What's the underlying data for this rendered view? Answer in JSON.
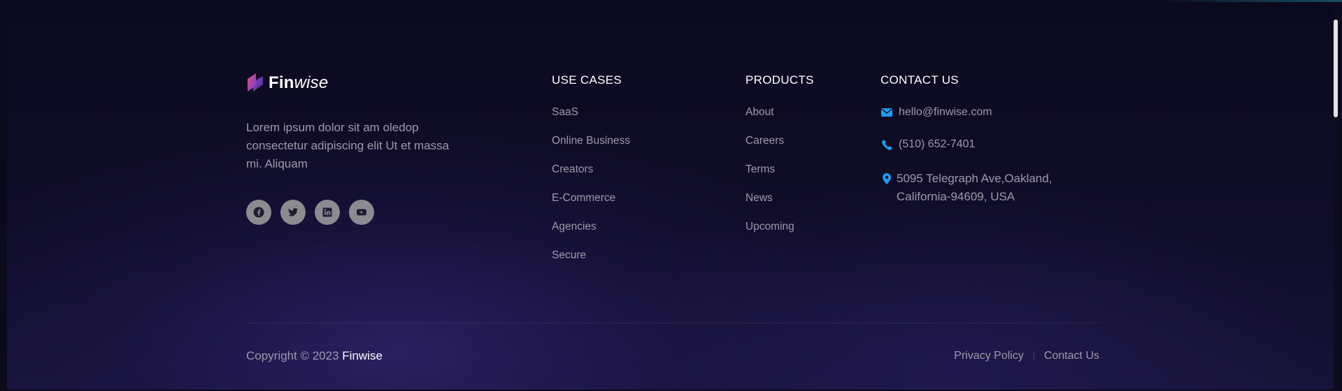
{
  "brand": {
    "name_bold": "Fin",
    "name_italic": "wise",
    "description": "Lorem ipsum dolor sit am oledop consectetur adipiscing elit Ut et massa mi. Aliquam",
    "social": [
      "facebook-icon",
      "twitter-icon",
      "linkedin-icon",
      "youtube-icon"
    ]
  },
  "use_cases": {
    "title": "USE CASES",
    "links": [
      "SaaS",
      "Online Business",
      "Creators",
      "E-Commerce",
      "Agencies",
      "Secure"
    ]
  },
  "products": {
    "title": "PRODUCTS",
    "links": [
      "About",
      "Careers",
      "Terms",
      "News",
      "Upcoming"
    ]
  },
  "contact": {
    "title": "CONTACT US",
    "email": "hello@finwise.com",
    "phone": "(510) 652-7401",
    "address_line1": "5095 Telegraph Ave,Oakland,",
    "address_line2": "California-94609, USA",
    "icon_color": "#1e9bf0"
  },
  "bottom": {
    "copyright_prefix": "Copyright © 2023",
    "copyright_brand": "Finwise",
    "privacy": "Privacy Policy",
    "contact_us": "Contact Us"
  },
  "colors": {
    "background": "#0b0a1c",
    "muted_text": "#9c9aaa",
    "heading": "#ffffff",
    "social_bg": "#8c8b92"
  }
}
